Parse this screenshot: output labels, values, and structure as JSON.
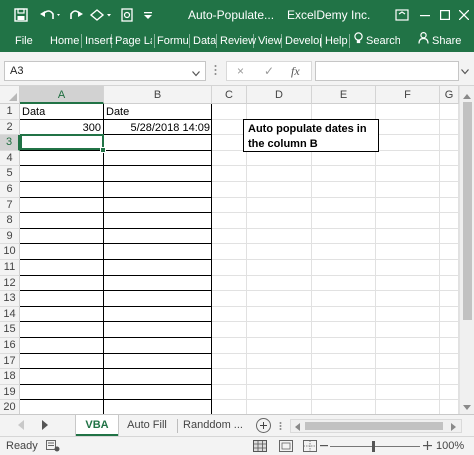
{
  "window": {
    "title": "Auto-Populate...",
    "owner": "ExcelDemy Inc."
  },
  "ribbon": {
    "tabs": [
      "File",
      "Home",
      "Insert",
      "Page La",
      "Formul",
      "Data",
      "Review",
      "View",
      "Develop",
      "Help"
    ],
    "search_label": "Search",
    "share_label": "Share"
  },
  "formula_bar": {
    "name_box": "A3",
    "cancel_icon": "×",
    "enter_icon": "✓",
    "fx_icon": "fx",
    "formula": ""
  },
  "grid": {
    "columns": [
      "A",
      "B",
      "C",
      "D",
      "E",
      "F",
      "G"
    ],
    "selected_column": "A",
    "rows": [
      "1",
      "2",
      "3",
      "4",
      "5",
      "6",
      "7",
      "8",
      "9",
      "10",
      "11",
      "12",
      "13",
      "14",
      "15",
      "16",
      "17",
      "18",
      "19",
      "20"
    ],
    "selected_row": "3",
    "cells": {
      "A1": "Data",
      "B1": "Date",
      "A2": "300",
      "B2": "5/28/2018 14:09"
    },
    "note": "Auto populate dates in the column B"
  },
  "sheet_tabs": {
    "tabs": [
      "VBA",
      "Auto Fill",
      "Randdom ..."
    ],
    "active": "VBA"
  },
  "status_bar": {
    "status": "Ready",
    "zoom": "100%"
  },
  "colors": {
    "accent": "#217346",
    "header_bg": "#f3f3f3"
  }
}
